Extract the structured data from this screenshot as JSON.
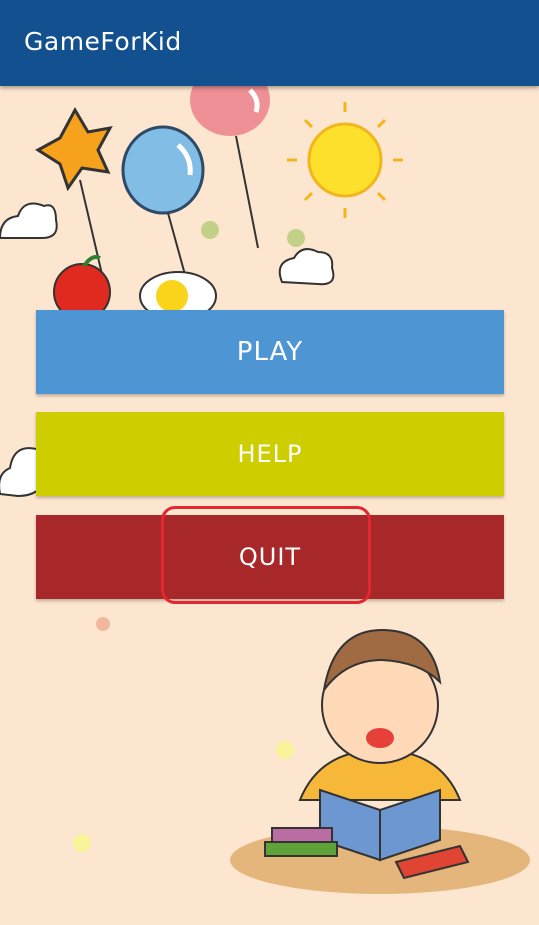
{
  "appbar": {
    "title": "GameForKid"
  },
  "menu": {
    "play_label": "PLAY",
    "help_label": "HELP",
    "quit_label": "QUIT"
  },
  "colors": {
    "appbar": "#12508f",
    "background": "#fde6cf",
    "play": "#4d95d3",
    "help": "#cdcd00",
    "quit": "#a8282a",
    "highlight": "#e5252f"
  }
}
